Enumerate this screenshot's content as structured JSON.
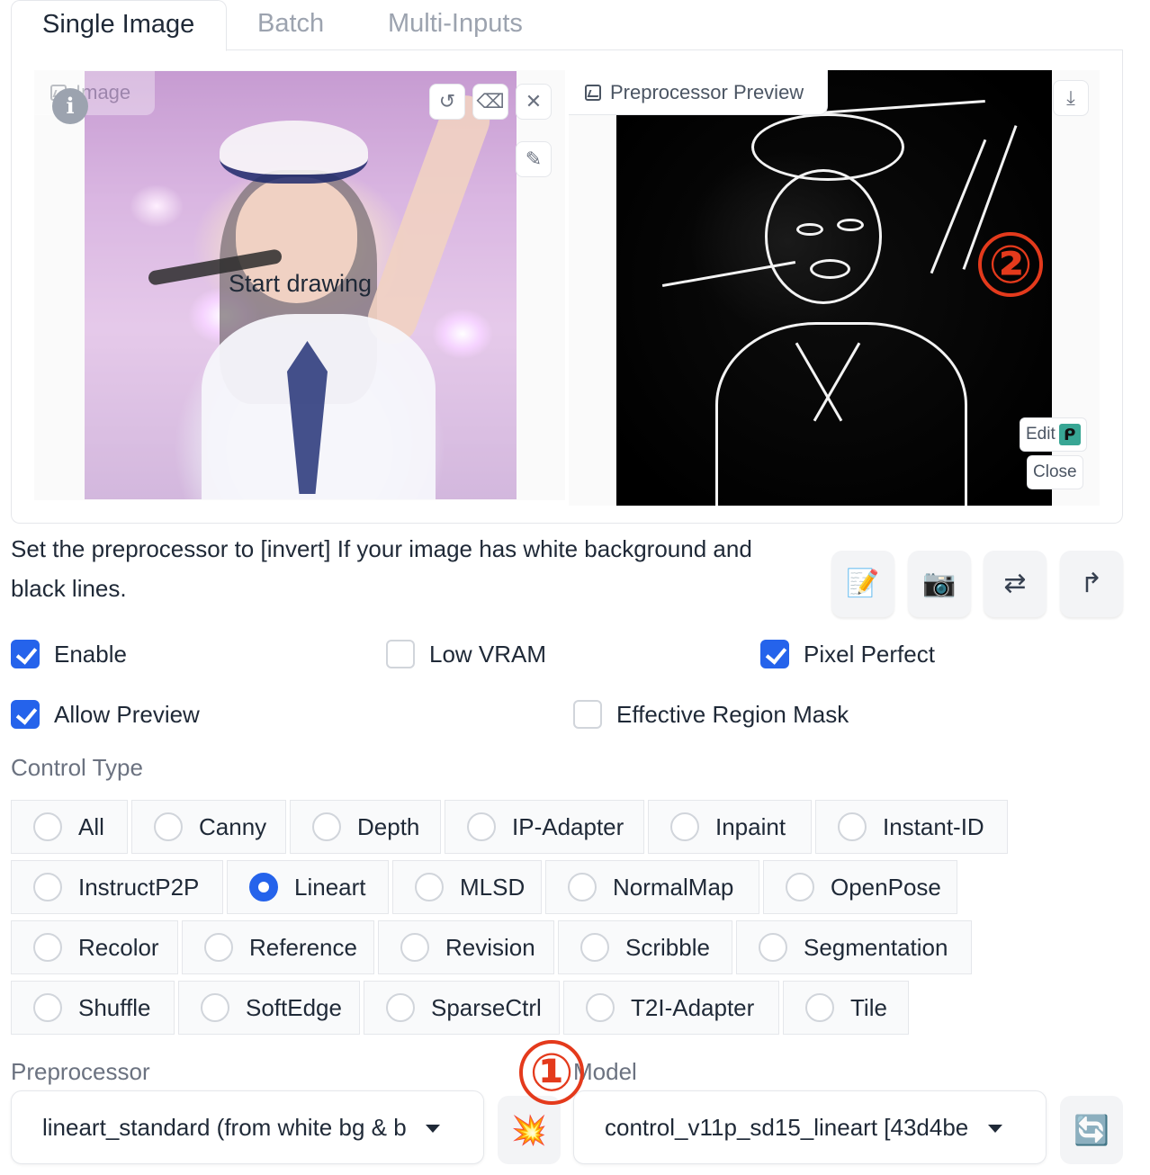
{
  "tabs": [
    "Single Image",
    "Batch",
    "Multi-Inputs"
  ],
  "image_panel": {
    "label": "Image",
    "overlay_text": "Start drawing"
  },
  "preview_panel": {
    "label": "Preprocessor Preview",
    "edit_label": "Edit",
    "close_label": "Close"
  },
  "annotations": [
    "①",
    "②"
  ],
  "note": "Set the preprocessor to [invert] If your image has white background and black lines.",
  "options": {
    "enable": {
      "label": "Enable",
      "checked": true
    },
    "low_vram": {
      "label": "Low VRAM",
      "checked": false
    },
    "pixel_perfect": {
      "label": "Pixel Perfect",
      "checked": true
    },
    "allow_preview": {
      "label": "Allow Preview",
      "checked": true
    },
    "effective_region_mask": {
      "label": "Effective Region Mask",
      "checked": false
    }
  },
  "control_type": {
    "label": "Control Type",
    "selected": "Lineart",
    "rows": [
      [
        "All",
        "Canny",
        "Depth",
        "IP-Adapter",
        "Inpaint",
        "Instant-ID"
      ],
      [
        "InstructP2P",
        "Lineart",
        "MLSD",
        "NormalMap",
        "OpenPose"
      ],
      [
        "Recolor",
        "Reference",
        "Revision",
        "Scribble",
        "Segmentation"
      ],
      [
        "Shuffle",
        "SoftEdge",
        "SparseCtrl",
        "T2I-Adapter",
        "Tile"
      ]
    ]
  },
  "preprocessor": {
    "label": "Preprocessor",
    "value": "lineart_standard (from white bg & b"
  },
  "model": {
    "label": "Model",
    "value": "control_v11p_sd15_lineart [43d4be"
  },
  "icons": {
    "edit": "📝",
    "camera": "📷",
    "swap": "⇄",
    "upload": "↱",
    "run": "💥",
    "refresh": "🔄"
  }
}
